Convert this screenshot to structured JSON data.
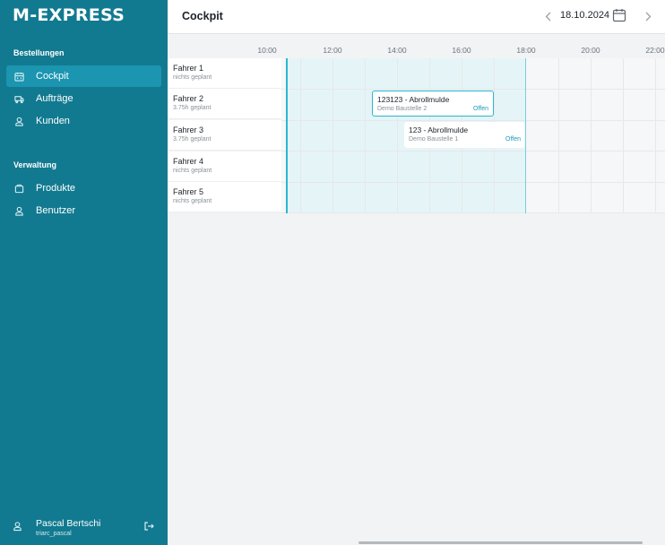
{
  "app": {
    "logo": "M-EXPRESS"
  },
  "sidebar": {
    "sections": [
      {
        "title": "Bestellungen"
      },
      {
        "title": "Verwaltung"
      }
    ],
    "items": [
      {
        "label": "Cockpit",
        "icon": "calendar-icon",
        "active": true
      },
      {
        "label": "Aufträge",
        "icon": "truck-icon"
      },
      {
        "label": "Kunden",
        "icon": "user-icon"
      },
      {
        "label": "Produkte",
        "icon": "box-icon"
      },
      {
        "label": "Benutzer",
        "icon": "user-icon"
      }
    ],
    "user": {
      "name": "Pascal Bertschi",
      "id": "triarc_pascal"
    }
  },
  "header": {
    "title": "Cockpit",
    "date": "18.10.2024"
  },
  "timeline": {
    "hours": [
      "10:00",
      "12:00",
      "14:00",
      "16:00",
      "18:00",
      "20:00",
      "22:00"
    ],
    "drivers": [
      {
        "name": "Fahrer 1",
        "planned": "nichts geplant"
      },
      {
        "name": "Fahrer 2",
        "planned": "3.75h geplant"
      },
      {
        "name": "Fahrer 3",
        "planned": "3.75h geplant"
      },
      {
        "name": "Fahrer 4",
        "planned": "nichts geplant"
      },
      {
        "name": "Fahrer 5",
        "planned": "nichts geplant"
      }
    ],
    "jobs": [
      {
        "title": "123123 - Abrollmulde",
        "site": "Demo Baustelle 2",
        "status": "Offen",
        "driver": "Fahrer 2"
      },
      {
        "title": "123 - Abrollmulde",
        "site": "Demo Baustelle 1",
        "status": "Offen",
        "driver": "Fahrer 3"
      }
    ]
  },
  "colors": {
    "sidebar": "#127a90",
    "active_item": "#1b95b0",
    "accent": "#2bb8d2"
  }
}
